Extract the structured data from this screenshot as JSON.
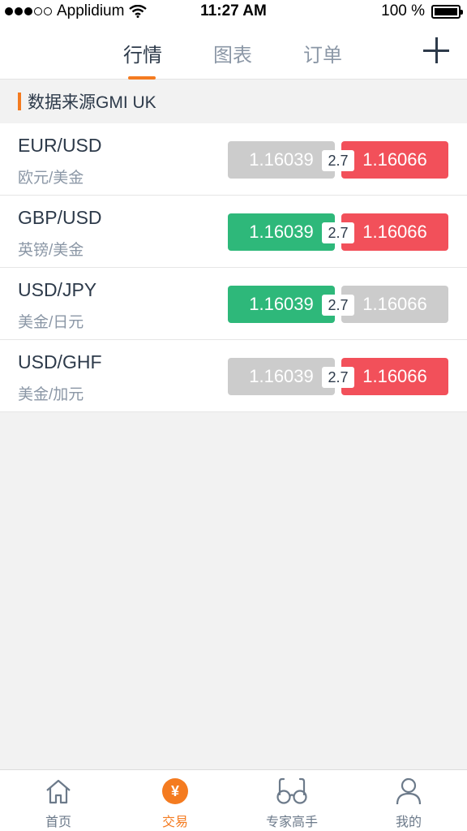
{
  "status_bar": {
    "carrier": "Applidium",
    "time": "11:27 AM",
    "battery": "100 %"
  },
  "top_nav": {
    "tabs": [
      {
        "label": "行情",
        "active": true
      },
      {
        "label": "图表",
        "active": false
      },
      {
        "label": "订单",
        "active": false
      }
    ],
    "add_icon": "plus-icon",
    "accent": "#f47b20"
  },
  "source": {
    "label": "数据来源GMI UK"
  },
  "quotes": [
    {
      "pair": "EUR/USD",
      "name": "欧元/美金",
      "bid": "1.16039",
      "spread": "2.7",
      "ask": "1.16066",
      "bid_color": "grey",
      "ask_color": "red"
    },
    {
      "pair": "GBP/USD",
      "name": "英镑/美金",
      "bid": "1.16039",
      "spread": "2.7",
      "ask": "1.16066",
      "bid_color": "green",
      "ask_color": "red"
    },
    {
      "pair": "USD/JPY",
      "name": "美金/日元",
      "bid": "1.16039",
      "spread": "2.7",
      "ask": "1.16066",
      "bid_color": "green",
      "ask_color": "grey"
    },
    {
      "pair": "USD/GHF",
      "name": "美金/加元",
      "bid": "1.16039",
      "spread": "2.7",
      "ask": "1.16066",
      "bid_color": "grey",
      "ask_color": "red"
    }
  ],
  "colors": {
    "up": "#2eb87a",
    "down": "#f2505a",
    "neutral": "#cccccc"
  },
  "bottom_nav": {
    "items": [
      {
        "label": "首页",
        "icon": "home-icon"
      },
      {
        "label": "交易",
        "icon": "yen-icon",
        "glyph": "¥",
        "active": true
      },
      {
        "label": "专家高手",
        "icon": "glasses-icon"
      },
      {
        "label": "我的",
        "icon": "user-icon"
      }
    ]
  }
}
